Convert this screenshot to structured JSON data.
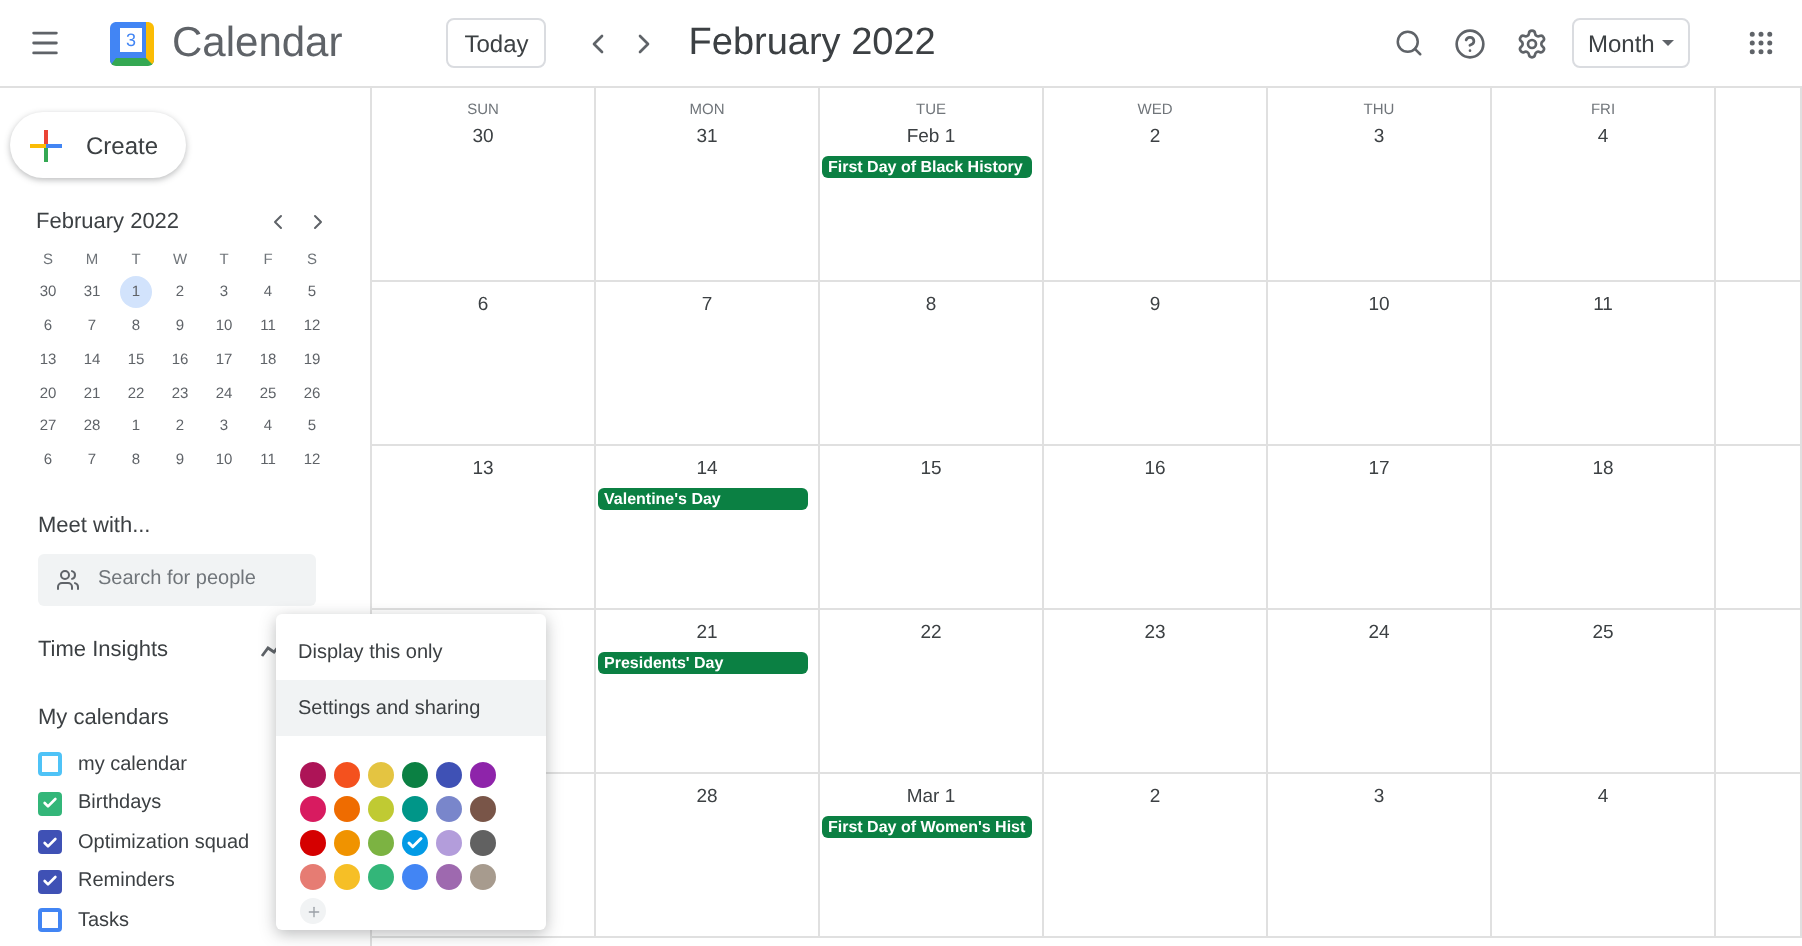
{
  "header": {
    "app_name": "Calendar",
    "logo_text": "3",
    "today_button": "Today",
    "title": "February 2022",
    "view_dropdown": "Month"
  },
  "sidebar": {
    "create_button": "Create",
    "mini_calendar": {
      "title": "February 2022",
      "weekdays": [
        "S",
        "M",
        "T",
        "W",
        "T",
        "F",
        "S"
      ],
      "weeks": [
        [
          {
            "d": "30",
            "selected": false
          },
          {
            "d": "31",
            "selected": false
          },
          {
            "d": "1",
            "selected": true
          },
          {
            "d": "2",
            "selected": false
          },
          {
            "d": "3",
            "selected": false
          },
          {
            "d": "4",
            "selected": false
          },
          {
            "d": "5",
            "selected": false
          }
        ],
        [
          {
            "d": "6",
            "selected": false
          },
          {
            "d": "7",
            "selected": false
          },
          {
            "d": "8",
            "selected": false
          },
          {
            "d": "9",
            "selected": false
          },
          {
            "d": "10",
            "selected": false
          },
          {
            "d": "11",
            "selected": false
          },
          {
            "d": "12",
            "selected": false
          }
        ],
        [
          {
            "d": "13",
            "selected": false
          },
          {
            "d": "14",
            "selected": false
          },
          {
            "d": "15",
            "selected": false
          },
          {
            "d": "16",
            "selected": false
          },
          {
            "d": "17",
            "selected": false
          },
          {
            "d": "18",
            "selected": false
          },
          {
            "d": "19",
            "selected": false
          }
        ],
        [
          {
            "d": "20",
            "selected": false
          },
          {
            "d": "21",
            "selected": false
          },
          {
            "d": "22",
            "selected": false
          },
          {
            "d": "23",
            "selected": false
          },
          {
            "d": "24",
            "selected": false
          },
          {
            "d": "25",
            "selected": false
          },
          {
            "d": "26",
            "selected": false
          }
        ],
        [
          {
            "d": "27",
            "selected": false
          },
          {
            "d": "28",
            "selected": false
          },
          {
            "d": "1",
            "selected": false
          },
          {
            "d": "2",
            "selected": false
          },
          {
            "d": "3",
            "selected": false
          },
          {
            "d": "4",
            "selected": false
          },
          {
            "d": "5",
            "selected": false
          }
        ],
        [
          {
            "d": "6",
            "selected": false
          },
          {
            "d": "7",
            "selected": false
          },
          {
            "d": "8",
            "selected": false
          },
          {
            "d": "9",
            "selected": false
          },
          {
            "d": "10",
            "selected": false
          },
          {
            "d": "11",
            "selected": false
          },
          {
            "d": "12",
            "selected": false
          }
        ]
      ]
    },
    "meet_heading": "Meet with...",
    "people_search": {
      "placeholder": "Search for people"
    },
    "time_insights": "Time Insights",
    "my_calendars_heading": "My calendars",
    "calendars": [
      {
        "name": "my calendar",
        "checked": false,
        "color": "#4fc3f7"
      },
      {
        "name": "Birthdays",
        "checked": true,
        "color": "#33b679"
      },
      {
        "name": "Optimization squad",
        "checked": true,
        "color": "#3f51b5"
      },
      {
        "name": "Reminders",
        "checked": true,
        "color": "#3f51b5"
      },
      {
        "name": "Tasks",
        "checked": false,
        "color": "#4285f4"
      }
    ]
  },
  "month_grid": {
    "day_names": [
      "SUN",
      "MON",
      "TUE",
      "WED",
      "THU",
      "FRI"
    ],
    "weeks": [
      [
        {
          "date": "30"
        },
        {
          "date": "31"
        },
        {
          "date": "Feb 1",
          "events": [
            {
              "title": "First Day of Black History",
              "color": "#0b8043"
            }
          ]
        },
        {
          "date": "2"
        },
        {
          "date": "3"
        },
        {
          "date": "4"
        }
      ],
      [
        {
          "date": "6"
        },
        {
          "date": "7"
        },
        {
          "date": "8"
        },
        {
          "date": "9"
        },
        {
          "date": "10"
        },
        {
          "date": "11"
        }
      ],
      [
        {
          "date": "13"
        },
        {
          "date": "14",
          "events": [
            {
              "title": "Valentine's Day",
              "color": "#0b8043"
            }
          ]
        },
        {
          "date": "15"
        },
        {
          "date": "16"
        },
        {
          "date": "17"
        },
        {
          "date": "18"
        }
      ],
      [
        {
          "date": "21",
          "events": [
            {
              "title": "Presidents' Day",
              "color": "#0b8043"
            }
          ]
        },
        {
          "date": "22"
        },
        {
          "date": "23"
        },
        {
          "date": "24"
        },
        {
          "date": "25"
        }
      ],
      [
        {
          "date": "28"
        },
        {
          "date": "Mar 1",
          "events": [
            {
              "title": "First Day of Women's Hist",
              "color": "#0b8043"
            }
          ]
        },
        {
          "date": "2"
        },
        {
          "date": "3"
        },
        {
          "date": "4"
        }
      ]
    ]
  },
  "popup_menu": {
    "items": [
      {
        "label": "Display this only",
        "selected": false
      },
      {
        "label": "Settings and sharing",
        "selected": true
      }
    ],
    "swatches": [
      {
        "color": "#ad1457",
        "selected": false
      },
      {
        "color": "#f4511e",
        "selected": false
      },
      {
        "color": "#e4c441",
        "selected": false
      },
      {
        "color": "#0b8043",
        "selected": false
      },
      {
        "color": "#3f51b5",
        "selected": false
      },
      {
        "color": "#8e24aa",
        "selected": false
      },
      {
        "color": "#d81b60",
        "selected": false
      },
      {
        "color": "#ef6c00",
        "selected": false
      },
      {
        "color": "#c0ca33",
        "selected": false
      },
      {
        "color": "#009688",
        "selected": false
      },
      {
        "color": "#7986cb",
        "selected": false
      },
      {
        "color": "#795548",
        "selected": false
      },
      {
        "color": "#d50000",
        "selected": false
      },
      {
        "color": "#f09300",
        "selected": false
      },
      {
        "color": "#7cb342",
        "selected": false
      },
      {
        "color": "#039be5",
        "selected": true
      },
      {
        "color": "#b39ddb",
        "selected": false
      },
      {
        "color": "#616161",
        "selected": false
      },
      {
        "color": "#e67c73",
        "selected": false
      },
      {
        "color": "#f6bf26",
        "selected": false
      },
      {
        "color": "#33b679",
        "selected": false
      },
      {
        "color": "#4285f4",
        "selected": false
      },
      {
        "color": "#9e69af",
        "selected": false
      },
      {
        "color": "#a79b8e",
        "selected": false
      }
    ]
  }
}
